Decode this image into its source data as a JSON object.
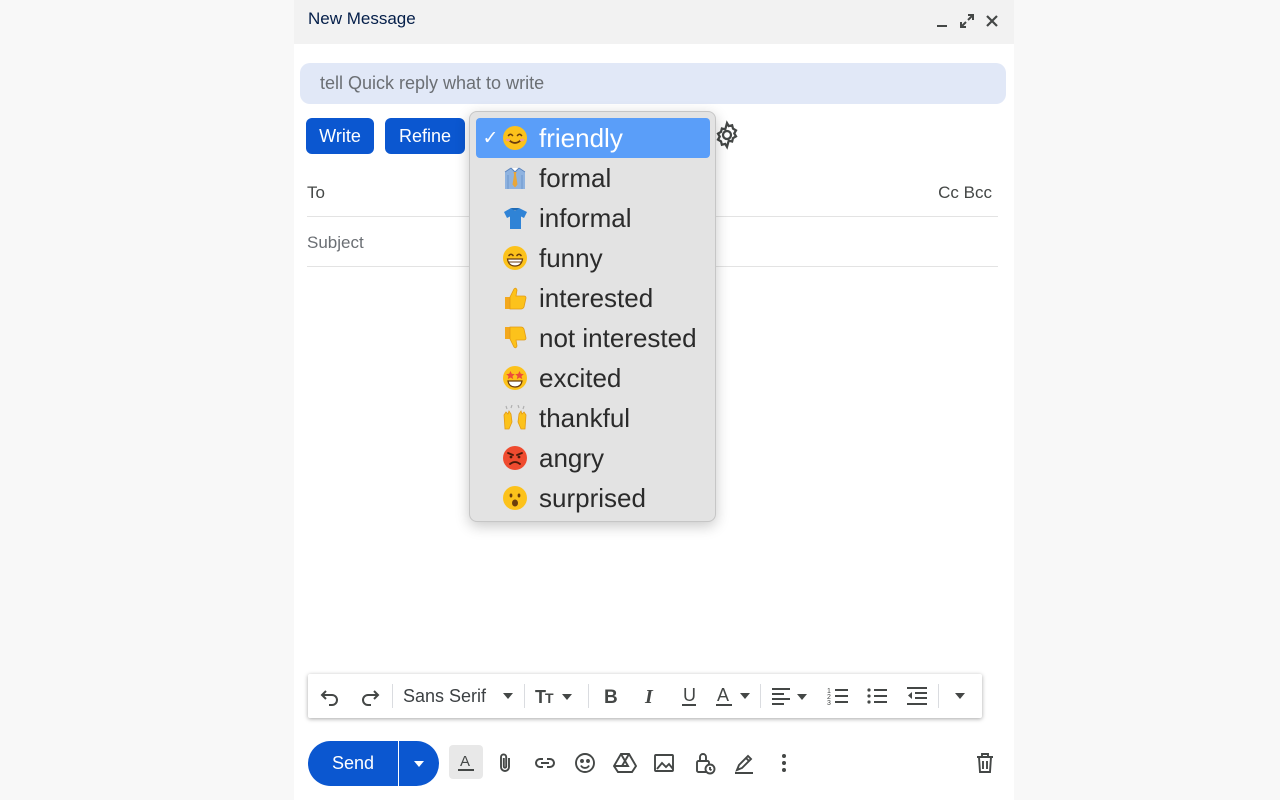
{
  "header": {
    "title": "New Message"
  },
  "quick_reply": {
    "placeholder": "tell Quick reply what to write"
  },
  "buttons": {
    "write": "Write",
    "refine": "Refine"
  },
  "fields": {
    "to_label": "To",
    "cc_bcc": "Cc Bcc",
    "subject_placeholder": "Subject"
  },
  "tones": [
    {
      "label": "friendly",
      "icon": "smiling-face-emoji",
      "selected": true
    },
    {
      "label": "formal",
      "icon": "necktie-shirt-emoji"
    },
    {
      "label": "informal",
      "icon": "t-shirt-emoji"
    },
    {
      "label": "funny",
      "icon": "grinning-face-emoji"
    },
    {
      "label": "interested",
      "icon": "thumbs-up-emoji"
    },
    {
      "label": "not interested",
      "icon": "thumbs-down-emoji"
    },
    {
      "label": "excited",
      "icon": "star-struck-emoji"
    },
    {
      "label": "thankful",
      "icon": "raising-hands-emoji"
    },
    {
      "label": "angry",
      "icon": "angry-face-emoji"
    },
    {
      "label": "surprised",
      "icon": "surprised-face-emoji"
    }
  ],
  "dropdown": {
    "checkmark": "✓"
  },
  "toolbar": {
    "font": "Sans Serif"
  },
  "send": {
    "label": "Send"
  },
  "colors": {
    "accent": "#0b57d0",
    "selection": "#5a9ef9",
    "quick_reply_bg": "#e1e8f7"
  }
}
